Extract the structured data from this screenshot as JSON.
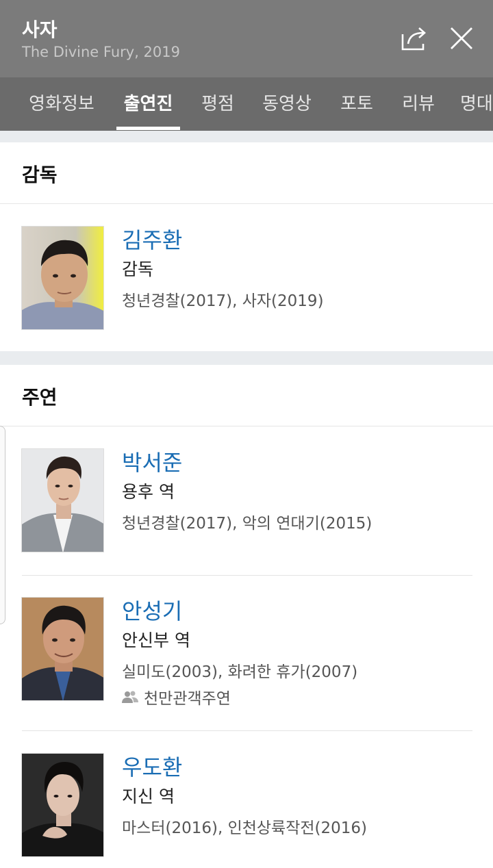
{
  "header": {
    "title": "사자",
    "subtitle": "The Divine Fury, 2019",
    "share_icon": "share-icon",
    "close_icon": "close-icon"
  },
  "tabs": [
    {
      "label": "영화정보",
      "active": false
    },
    {
      "label": "출연진",
      "active": true
    },
    {
      "label": "평점",
      "active": false
    },
    {
      "label": "동영상",
      "active": false
    },
    {
      "label": "포토",
      "active": false
    },
    {
      "label": "리뷰",
      "active": false
    },
    {
      "label": "명대",
      "active": false
    }
  ],
  "director_section": {
    "title": "감독",
    "people": [
      {
        "name": "김주환",
        "role": "감독",
        "works": "청년경찰(2017), 사자(2019)"
      }
    ]
  },
  "cast_section": {
    "title": "주연",
    "people": [
      {
        "name": "박서준",
        "role": "용후 역",
        "works": "청년경찰(2017), 악의 연대기(2015)"
      },
      {
        "name": "안성기",
        "role": "안신부 역",
        "works": "실미도(2003), 화려한 휴가(2007)",
        "badge": "천만관객주연"
      },
      {
        "name": "우도환",
        "role": "지신 역",
        "works": "마스터(2016), 인천상륙작전(2016)"
      }
    ]
  },
  "colors": {
    "header_bg": "#7b7b7b",
    "tabs_bg": "#6b6b6b",
    "name_link": "#1a6db4",
    "section_gap": "#e9ecef"
  }
}
